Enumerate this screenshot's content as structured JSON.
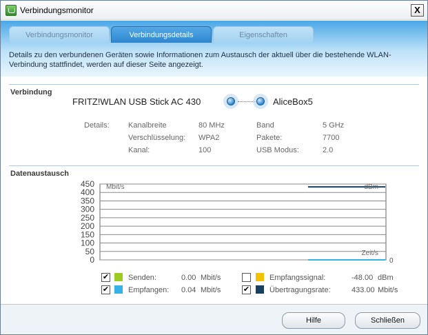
{
  "window": {
    "title": "Verbindungsmonitor",
    "close_glyph": "X"
  },
  "tabs": [
    {
      "label": "Verbindungsmonitor",
      "active": false
    },
    {
      "label": "Verbindungsdetails",
      "active": true
    },
    {
      "label": "Eigenschaften",
      "active": false
    }
  ],
  "header": {
    "description": "Details zu den verbundenen Geräten sowie Informationen zum Austausch der aktuell über die bestehende WLAN-Verbindung stattfindet, werden auf dieser Seite angezeigt."
  },
  "connection": {
    "section_title": "Verbindung",
    "device_left": "FRITZ!WLAN USB Stick AC 430",
    "device_right": "AliceBox5",
    "details_label": "Details:",
    "details": [
      {
        "key": "Kanalbreite",
        "value": "80 MHz"
      },
      {
        "key": "Verschlüsselung:",
        "value": "WPA2"
      },
      {
        "key": "Kanal:",
        "value": "100"
      },
      {
        "key": "Band",
        "value": "5 GHz"
      },
      {
        "key": "Pakete:",
        "value": "7700"
      },
      {
        "key": "USB Modus:",
        "value": "2.0"
      }
    ]
  },
  "exchange": {
    "section_title": "Datenaustausch",
    "legend": [
      {
        "checked": true,
        "label": "Senden:",
        "value": "0.00",
        "unit": "Mbit/s",
        "color": "#9ccc1f"
      },
      {
        "checked": true,
        "label": "Empfangen:",
        "value": "0.04",
        "unit": "Mbit/s",
        "color": "#35b3e6"
      },
      {
        "checked": false,
        "label": "Empfangssignal:",
        "value": "-48.00",
        "unit": "dBm",
        "color": "#f2c200"
      },
      {
        "checked": true,
        "label": "Übertragungsrate:",
        "value": "433.00",
        "unit": "Mbit/s",
        "color": "#173f5f"
      }
    ]
  },
  "chart_data": {
    "type": "line",
    "y_ticks": [
      "450",
      "400",
      "350",
      "300",
      "250",
      "200",
      "150",
      "100",
      "50",
      "0"
    ],
    "ylim": [
      0,
      450
    ],
    "ylabel": "Mbit/s",
    "y2label": "dBm",
    "xlabel": "Zeit/s",
    "x2_tick": "0",
    "grid": true,
    "series": [
      {
        "name": "Übertragungsrate",
        "color": "#173f5f",
        "values": [
          433,
          433
        ]
      },
      {
        "name": "Empfangen",
        "color": "#35b3e6",
        "values": [
          0.04,
          0.04
        ]
      }
    ]
  },
  "buttons": {
    "help": "Hilfe",
    "close": "Schließen"
  }
}
